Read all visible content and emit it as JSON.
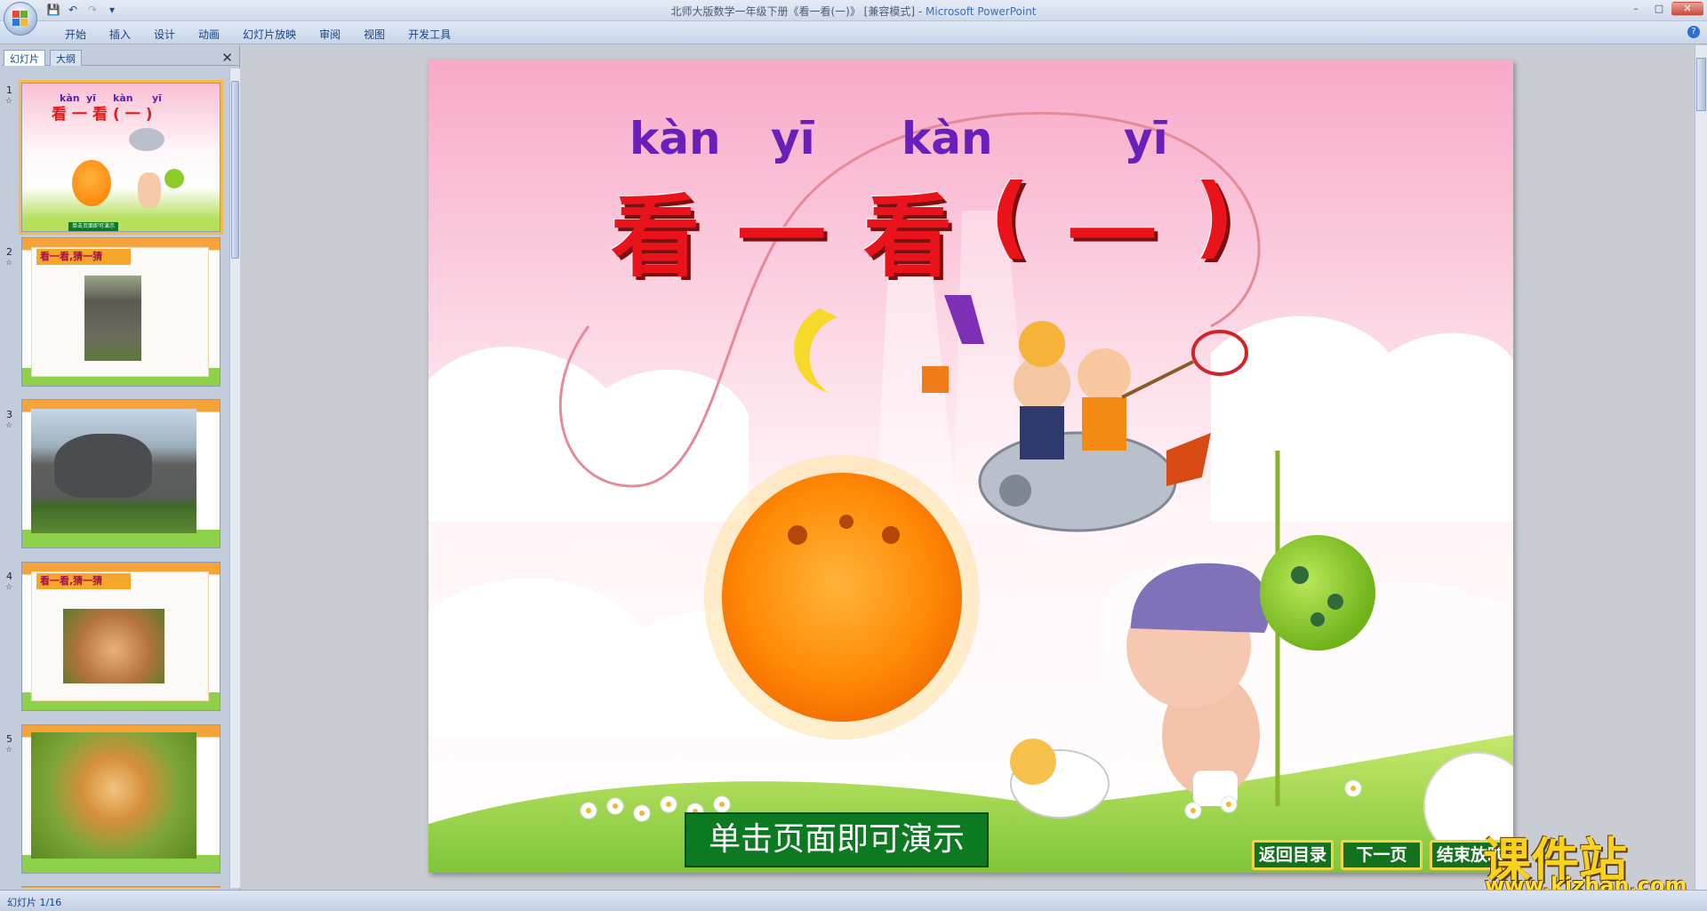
{
  "window": {
    "title_doc": "北师大版数学一年级下册《看一看(一)》 [兼容模式] - ",
    "title_app": "Microsoft PowerPoint",
    "controls": [
      "–",
      "□",
      "✕"
    ]
  },
  "qat": {
    "save": "💾",
    "undo": "↶",
    "redo": "↷",
    "customize": "▾"
  },
  "ribbon": {
    "tabs": [
      "开始",
      "插入",
      "设计",
      "动画",
      "幻灯片放映",
      "审阅",
      "视图",
      "开发工具"
    ],
    "help": "?"
  },
  "panel": {
    "tab_slides": "幻灯片",
    "tab_outline": "大纲",
    "close": "✕",
    "thumbnails": [
      {
        "num": "1",
        "star": "☆",
        "pinyin": [
          "kàn",
          "yī",
          "kàn",
          "yī"
        ],
        "title": "看一看(一)",
        "button": "单击页面即可演示"
      },
      {
        "num": "2",
        "star": "☆",
        "label": "看一看,猜一猜",
        "image": "elephant-closeup"
      },
      {
        "num": "3",
        "star": "☆",
        "image": "elephant-full"
      },
      {
        "num": "4",
        "star": "☆",
        "label": "看一看,猜一猜",
        "image": "cat-face"
      },
      {
        "num": "5",
        "star": "☆",
        "image": "kitten-full"
      }
    ]
  },
  "slide": {
    "pinyin": [
      "kàn",
      "yī",
      "kàn",
      "yī"
    ],
    "title": [
      "看",
      "一",
      "看",
      "(",
      "一",
      ")"
    ],
    "start_button": "单击页面即可演示",
    "nav": {
      "back": "返回目录",
      "next": "下一页",
      "end": "结束放映"
    }
  },
  "status": {
    "slide_count": "幻灯片 1/16"
  },
  "watermark": {
    "name": "课件站",
    "url": "www.kjzhan.com"
  }
}
